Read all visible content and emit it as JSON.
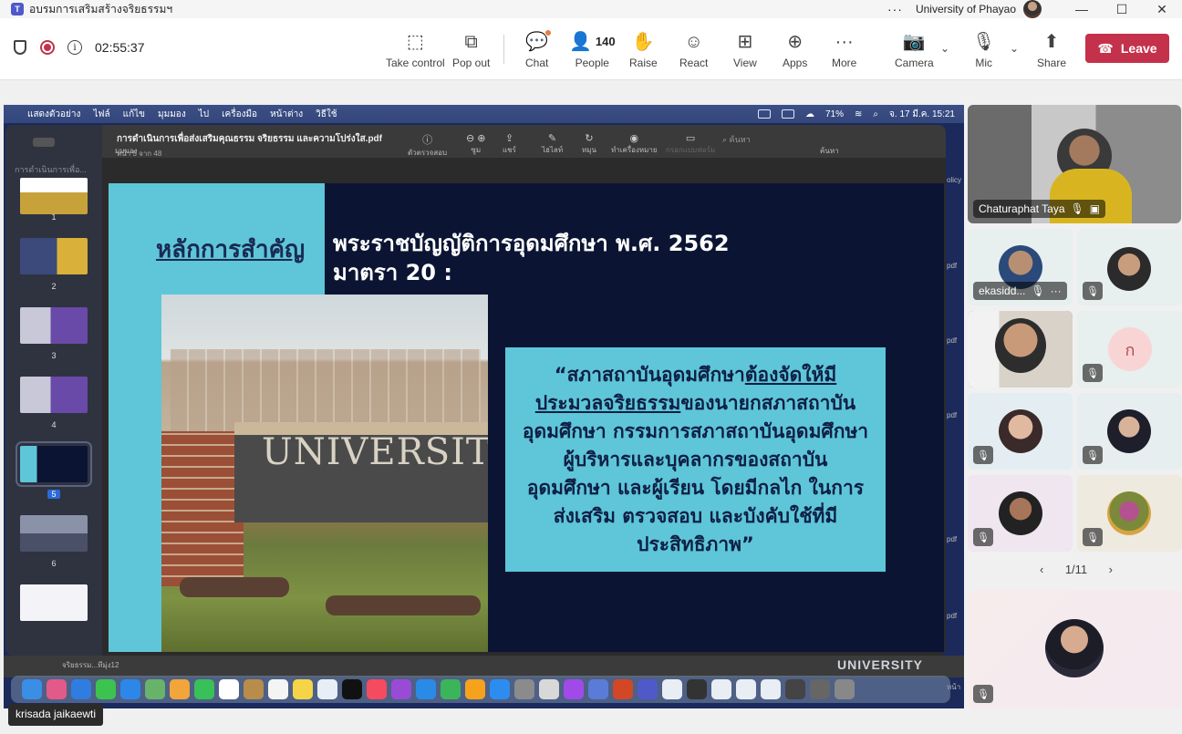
{
  "window": {
    "app_icon": "teams-icon",
    "title": "อบรมการเสริมสร้างจริยธรรมฯ",
    "org": "University of Phayao",
    "more": "···"
  },
  "toolbar": {
    "timer": "02:55:37",
    "buttons": {
      "take_control": "Take control",
      "pop_out": "Pop out",
      "chat": "Chat",
      "people": "People",
      "people_count": "140",
      "raise": "Raise",
      "react": "React",
      "view": "View",
      "apps": "Apps",
      "more": "More",
      "camera": "Camera",
      "mic": "Mic",
      "share": "Share",
      "leave": "Leave"
    },
    "colors": {
      "leave": "#c4314b",
      "record": "#c4314b"
    }
  },
  "shared_screen": {
    "mac_menu": [
      "แสดงตัวอย่าง",
      "ไฟล์",
      "แก้ไข",
      "มุมมอง",
      "ไป",
      "เครื่องมือ",
      "หน้าต่าง",
      "วิธีใช้"
    ],
    "mac_status": {
      "battery": "71%",
      "datetime": "จ. 17 มี.ค.  15:21"
    },
    "viewer": {
      "doc_name": "การดำเนินการเพื่อส่งเสริมคุณธรรม จริยธรรม และความโปร่งใส.pdf",
      "page_info": "หน้า 5 จาก 48",
      "toolbar_items": [
        "มุมมอง",
        "ตัวตรวจสอบ",
        "ซูม",
        "แชร์",
        "ไฮไลท์",
        "หมุน",
        "ทำเครื่องหมาย",
        "กรอกแบบฟอร์ม",
        "ค้นหา"
      ],
      "search_placeholder": "ค้นหา",
      "sidebar_head": "การดำเนินการเพื่อ...",
      "thumbnails": [
        "1",
        "2",
        "3",
        "4",
        "5",
        "6"
      ],
      "selected_page": "5",
      "right_strip": [
        "olicy",
        "pdf",
        "pdf",
        "pdf",
        "pdf",
        "pdf",
        "หน้า"
      ],
      "bottom_text": "จริยธรรม...ทีมุ่ง12",
      "bottom_univ": "UNIVERSITY"
    },
    "slide": {
      "principle": "หลักการสำคัญ",
      "heading1": "พระราชบัญญัติการอุดมศึกษา พ.ศ. 2562",
      "heading2": "มาตรา 20 :",
      "photo_sign": "UNIVERSITY",
      "quote_pre": "“สภาสถาบันอุดมศึกษา",
      "quote_u": "ต้องจัดให้มีประมวลจริยธรรม",
      "quote_post": "ของนายกสภาสถาบันอุดมศึกษา กรรมการสภาสถาบันอุดมศึกษา ผู้บริหารและบุคลากรของสถาบันอุดมศึกษา และผู้เรียน โดยมีกลไก ในการส่งเสริม ตรวจสอบ และบังคับใช้ที่มีประสิทธิภาพ”",
      "colors": {
        "band": "#5ec6d8",
        "background": "#0b1533"
      }
    },
    "presenter": "krisada jaikaewti"
  },
  "gallery": {
    "featured_name": "Chaturaphat Taya",
    "tiles": [
      {
        "name": "ekasidd...",
        "muted": true
      },
      {
        "name": "",
        "muted": true
      },
      {
        "name": "",
        "muted": true,
        "active_speaker": true
      },
      {
        "name": "",
        "muted": true,
        "initial": "ก"
      },
      {
        "name": "",
        "muted": true
      },
      {
        "name": "",
        "muted": true
      },
      {
        "name": "",
        "muted": true
      },
      {
        "name": "",
        "muted": true
      }
    ],
    "pager": "1/11"
  }
}
